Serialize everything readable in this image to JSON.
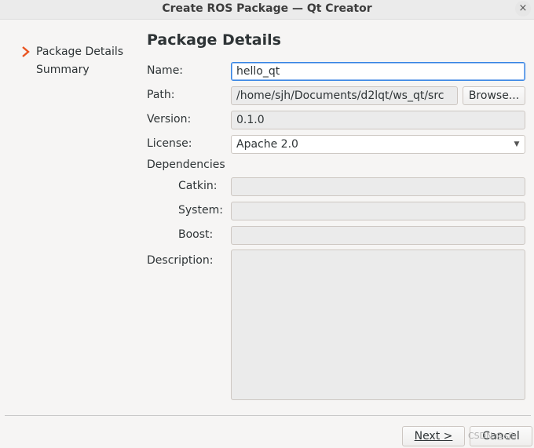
{
  "window": {
    "title": "Create ROS Package — Qt Creator",
    "close_glyph": "×"
  },
  "sidebar": {
    "items": [
      {
        "label": "Package Details",
        "current": true
      },
      {
        "label": "Summary",
        "current": false
      }
    ]
  },
  "page": {
    "title": "Package Details",
    "name_label": "Name:",
    "name_value": "hello_qt",
    "path_label": "Path:",
    "path_value": "/home/sjh/Documents/d2lqt/ws_qt/src",
    "browse_label": "Browse...",
    "version_label": "Version:",
    "version_value": "0.1.0",
    "license_label": "License:",
    "license_value": "Apache 2.0",
    "dependencies_label": "Dependencies",
    "catkin_label": "Catkin:",
    "catkin_value": "",
    "system_label": "System:",
    "system_value": "",
    "boost_label": "Boost:",
    "boost_value": "",
    "description_label": "Description:",
    "description_value": ""
  },
  "footer": {
    "next_label": "Next >",
    "cancel_label": "Cancel",
    "watermark": "CSDN @sjh"
  },
  "colors": {
    "accent": "#3584e4",
    "step_arrow": "#e95420"
  }
}
